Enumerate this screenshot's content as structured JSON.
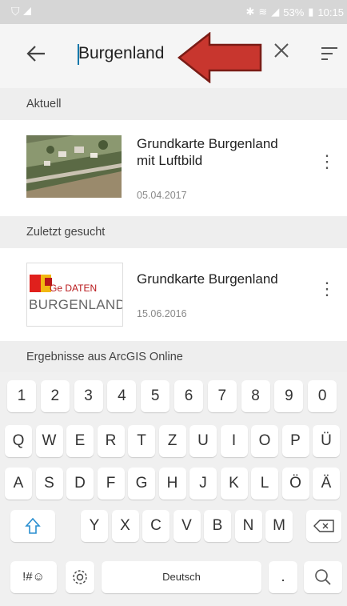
{
  "status_bar": {
    "battery": "53%",
    "time": "10:15"
  },
  "search": {
    "query": "Burgenland"
  },
  "sections": {
    "current": "Aktuell",
    "recent": "Zuletzt gesucht",
    "results": "Ergebnisse aus ArcGIS Online"
  },
  "items": {
    "current": {
      "title": "Grundkarte Burgenland mit Luftbild",
      "date": "05.04.2017"
    },
    "recent": {
      "title": "Grundkarte Burgenland",
      "date": "15.06.2016",
      "logo_line1": "Ge DATEN",
      "logo_line2": "BURGENLAND"
    }
  },
  "keyboard": {
    "row_numbers": [
      "1",
      "2",
      "3",
      "4",
      "5",
      "6",
      "7",
      "8",
      "9",
      "0"
    ],
    "row1": [
      "Q",
      "W",
      "E",
      "R",
      "T",
      "Z",
      "U",
      "I",
      "O",
      "P",
      "Ü"
    ],
    "row2": [
      "A",
      "S",
      "D",
      "F",
      "G",
      "H",
      "J",
      "K",
      "L",
      "Ö",
      "Ä"
    ],
    "row3": [
      "Y",
      "X",
      "C",
      "V",
      "B",
      "N",
      "M"
    ],
    "symbols_key": "!#☺",
    "space_label": "Deutsch",
    "period": "."
  },
  "colors": {
    "arrow_fill": "#c8362e",
    "arrow_stroke": "#7a1c16",
    "accent": "#1e88c8"
  }
}
